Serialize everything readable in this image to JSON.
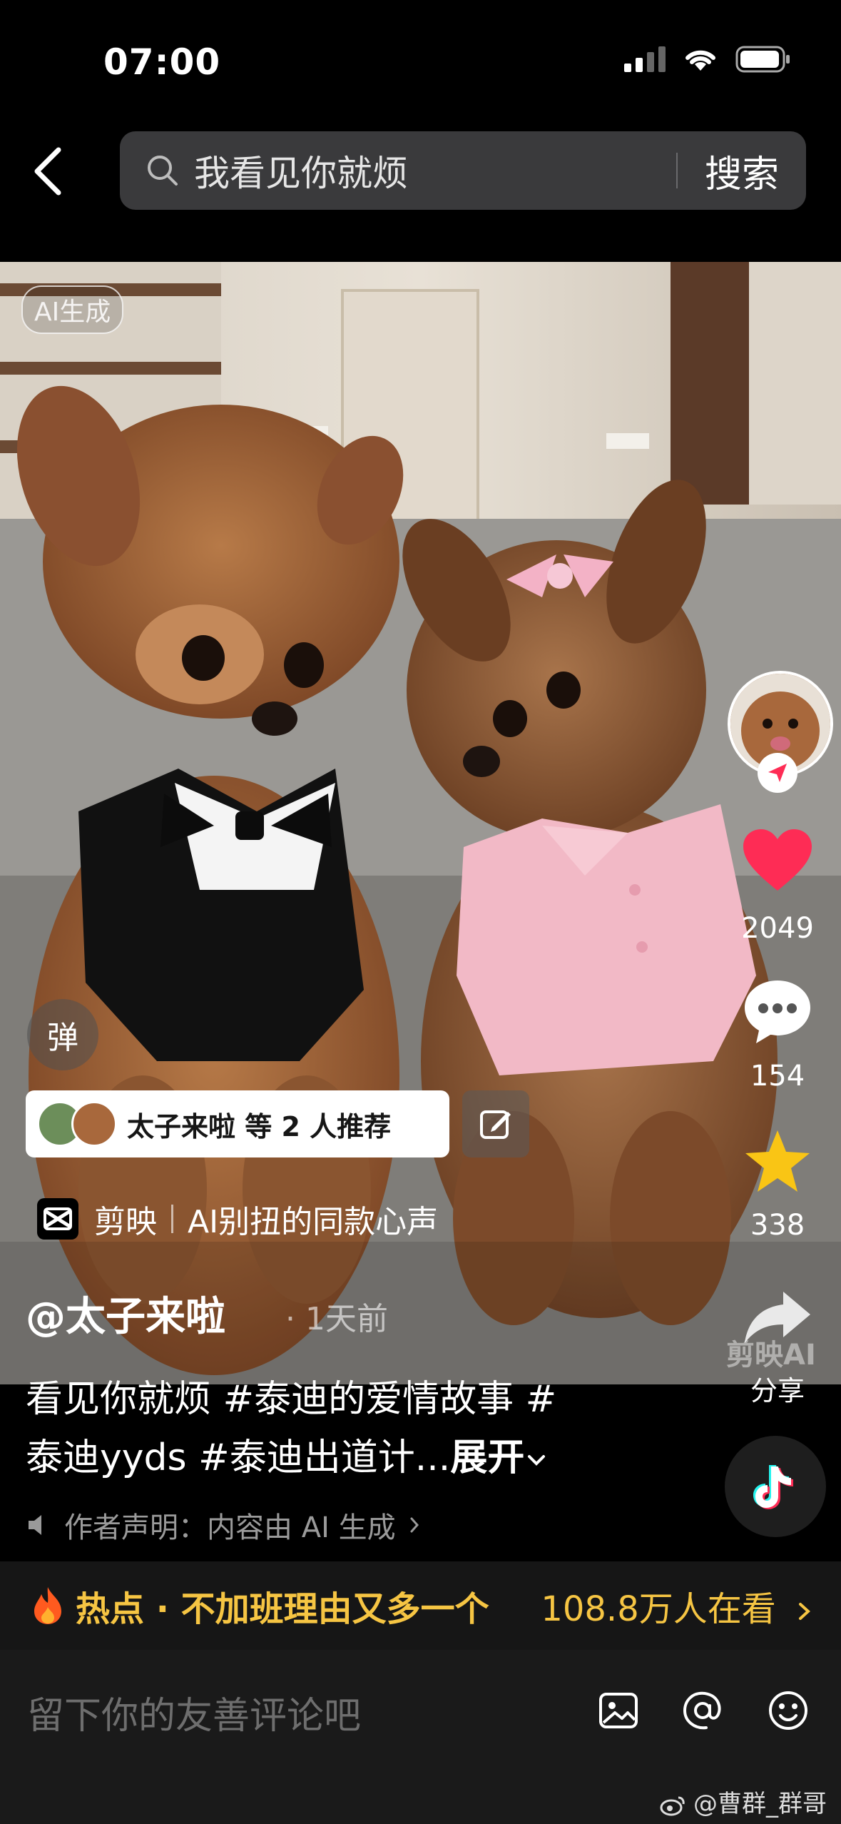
{
  "status_bar": {
    "time": "07:00"
  },
  "search": {
    "query": "我看见你就烦",
    "button": "搜索"
  },
  "video": {
    "ai_badge": "AI生成",
    "danmaku_label": "弹",
    "recommend_text": "太子来啦 等 2 人推荐",
    "capcut_brand": "剪映",
    "capcut_template": "AI别扭的同款心声"
  },
  "right_rail": {
    "likes": "2049",
    "comments": "154",
    "favorites": "338",
    "share_label": "分享",
    "watermark": "剪映AI"
  },
  "post": {
    "author": "@太子来啦",
    "time_ago": "· 1天前",
    "caption_line1": "看见你就烦 #泰迪的爱情故事 #",
    "caption_line2": "泰迪yyds #泰迪出道计...",
    "expand": "展开",
    "declaration": "作者声明：内容由 AI 生成"
  },
  "hot_banner": {
    "text": "热点 · 不加班理由又多一个",
    "viewers": "108.8万人在看"
  },
  "comment_bar": {
    "placeholder": "留下你的友善评论吧"
  },
  "watermark_credit": "@曹群_群哥",
  "colors": {
    "like": "#fe2c55",
    "favorite": "#f9c515",
    "hot": "#f6c543"
  }
}
